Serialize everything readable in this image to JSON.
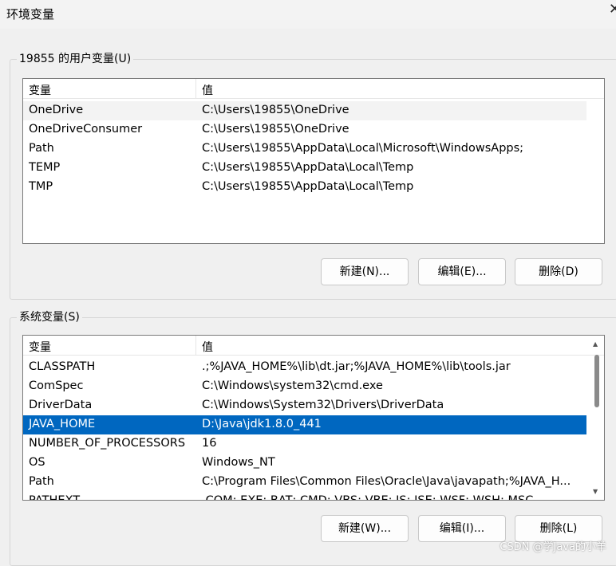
{
  "window": {
    "title": "环境变量"
  },
  "user_section": {
    "legend": "19855 的用户变量(U)",
    "columns": [
      "变量",
      "值"
    ],
    "rows": [
      {
        "name": "OneDrive",
        "value": "C:\\Users\\19855\\OneDrive"
      },
      {
        "name": "OneDriveConsumer",
        "value": "C:\\Users\\19855\\OneDrive"
      },
      {
        "name": "Path",
        "value": "C:\\Users\\19855\\AppData\\Local\\Microsoft\\WindowsApps;"
      },
      {
        "name": "TEMP",
        "value": "C:\\Users\\19855\\AppData\\Local\\Temp"
      },
      {
        "name": "TMP",
        "value": "C:\\Users\\19855\\AppData\\Local\\Temp"
      }
    ],
    "buttons": {
      "new": "新建(N)...",
      "edit": "编辑(E)...",
      "delete": "删除(D)"
    }
  },
  "system_section": {
    "legend": "系统变量(S)",
    "columns": [
      "变量",
      "值"
    ],
    "rows": [
      {
        "name": "CLASSPATH",
        "value": ".;%JAVA_HOME%\\lib\\dt.jar;%JAVA_HOME%\\lib\\tools.jar"
      },
      {
        "name": "ComSpec",
        "value": "C:\\Windows\\system32\\cmd.exe"
      },
      {
        "name": "DriverData",
        "value": "C:\\Windows\\System32\\Drivers\\DriverData"
      },
      {
        "name": "JAVA_HOME",
        "value": "D:\\Java\\jdk1.8.0_441"
      },
      {
        "name": "NUMBER_OF_PROCESSORS",
        "value": "16"
      },
      {
        "name": "OS",
        "value": "Windows_NT"
      },
      {
        "name": "Path",
        "value": "C:\\Program Files\\Common Files\\Oracle\\Java\\javapath;%JAVA_H..."
      },
      {
        "name": "PATHEXT",
        "value": ".COM;.EXE;.BAT;.CMD;.VBS;.VBE;.JS;.JSE;.WSF;.WSH;.MSC"
      }
    ],
    "buttons": {
      "new": "新建(W)...",
      "edit": "编辑(I)...",
      "delete": "删除(L)"
    }
  },
  "watermark": "CSDN @学Java的小羊",
  "colors": {
    "selected_bg": "#0067c0",
    "hover_bg": "#e5f3ff",
    "accent": "#0067c0"
  }
}
